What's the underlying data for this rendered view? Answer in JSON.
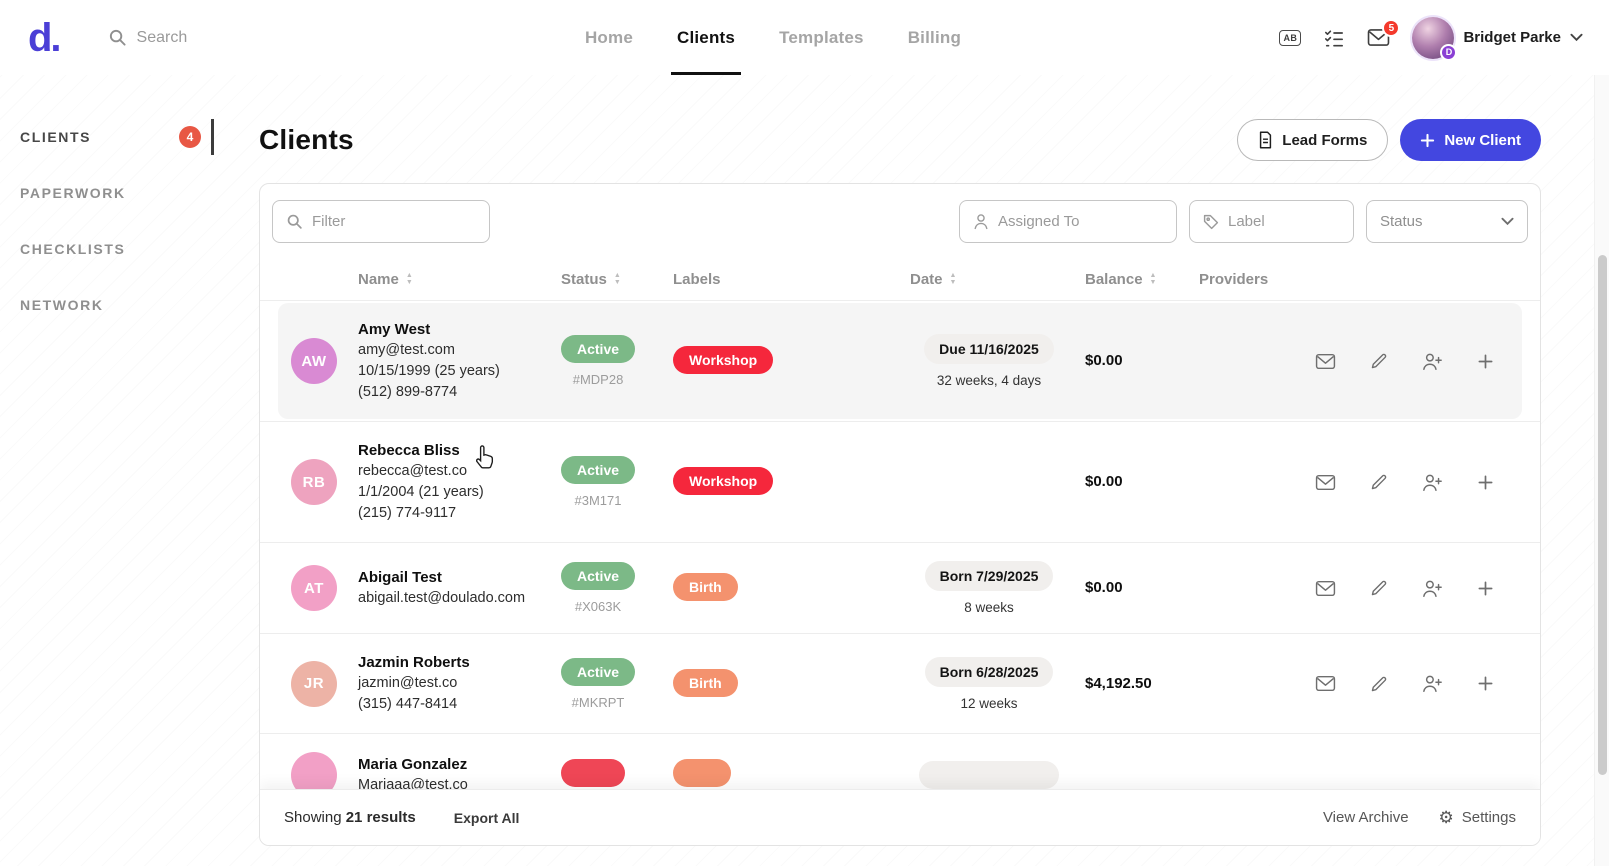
{
  "navbar": {
    "logo": "d.",
    "search": {
      "placeholder": "Search"
    },
    "nav_items": [
      {
        "label": "Home"
      },
      {
        "label": "Clients"
      },
      {
        "label": "Templates"
      },
      {
        "label": "Billing"
      }
    ],
    "ab_label": "AB",
    "mail_badge": "5",
    "user": {
      "name": "Bridget Parke",
      "badge": "D"
    }
  },
  "sidebar": {
    "items": [
      {
        "label": "CLIENTS",
        "badge": "4"
      },
      {
        "label": "PAPERWORK",
        "badge": ""
      },
      {
        "label": "CHECKLISTS",
        "badge": ""
      },
      {
        "label": "NETWORK",
        "badge": ""
      }
    ]
  },
  "page": {
    "title": "Clients",
    "lead_forms_button": "Lead Forms",
    "new_client_button": "New Client"
  },
  "filters": {
    "filter_placeholder": "Filter",
    "assigned_to": "Assigned To",
    "label": "Label",
    "status": "Status"
  },
  "table": {
    "headers": [
      {
        "label": "Name"
      },
      {
        "label": "Status"
      },
      {
        "label": "Labels"
      },
      {
        "label": "Date"
      },
      {
        "label": "Balance"
      },
      {
        "label": "Providers"
      }
    ],
    "rows": [
      {
        "initials": "AW",
        "avatar_color": "#d98ad3",
        "name": "Amy West",
        "contact": [
          "amy@test.com",
          "10/15/1999 (25 years)",
          "(512) 899-8774"
        ],
        "status": "Active",
        "status_color": "#7cb987",
        "code": "#MDP28",
        "label": {
          "text": "Workshop",
          "color": "#f5273c"
        },
        "date_main": "Due 11/16/2025",
        "date_sub": "32 weeks, 4 days",
        "balance": "$0.00"
      },
      {
        "initials": "RB",
        "avatar_color": "#eea3bf",
        "name": "Rebecca Bliss",
        "contact": [
          "rebecca@test.co",
          "1/1/2004 (21 years)",
          "(215) 774-9117"
        ],
        "status": "Active",
        "status_color": "#7cb987",
        "code": "#3M171",
        "label": {
          "text": "Workshop",
          "color": "#f5273c"
        },
        "date_main": "",
        "date_sub": "",
        "balance": "$0.00"
      },
      {
        "initials": "AT",
        "avatar_color": "#f2a0c6",
        "name": "Abigail Test",
        "contact": [
          "abigail.test@doulado.com",
          "",
          ""
        ],
        "status": "Active",
        "status_color": "#7cb987",
        "code": "#X063K",
        "label": {
          "text": "Birth",
          "color": "#f4926e"
        },
        "date_main": "Born 7/29/2025",
        "date_sub": "8 weeks",
        "balance": "$0.00"
      },
      {
        "initials": "JR",
        "avatar_color": "#edb3a6",
        "name": "Jazmin Roberts",
        "contact": [
          "jazmin@test.co",
          "(315) 447-8414",
          ""
        ],
        "status": "Active",
        "status_color": "#7cb987",
        "code": "#MKRPT",
        "label": {
          "text": "Birth",
          "color": "#f4926e"
        },
        "date_main": "Born 6/28/2025",
        "date_sub": "12 weeks",
        "balance": "$4,192.50"
      },
      {
        "initials": "",
        "avatar_color": "#f2a0c6",
        "name": "Maria Gonzalez",
        "contact": [
          "Mariaaa@test.co",
          "",
          ""
        ],
        "status_color": "#ef4656",
        "label": {
          "color": "#f4926e"
        },
        "date_color": "#f1efed"
      }
    ]
  },
  "footer": {
    "showing_prefix": "Showing",
    "showing_count": "21 results",
    "export_all": "Export All",
    "view_archive": "View Archive",
    "settings": "Settings"
  },
  "icons": {
    "gear": "⚙",
    "sort_up": "▲",
    "sort_down": "▼"
  },
  "colors": {
    "accent": "#4347e0",
    "active_green": "#7cb987",
    "workshop_red": "#f5273c",
    "birth_orange": "#f4926e",
    "badge_orange": "#e85744",
    "badge_red": "#f4392c",
    "date_pill_gray": "#f1efed"
  }
}
